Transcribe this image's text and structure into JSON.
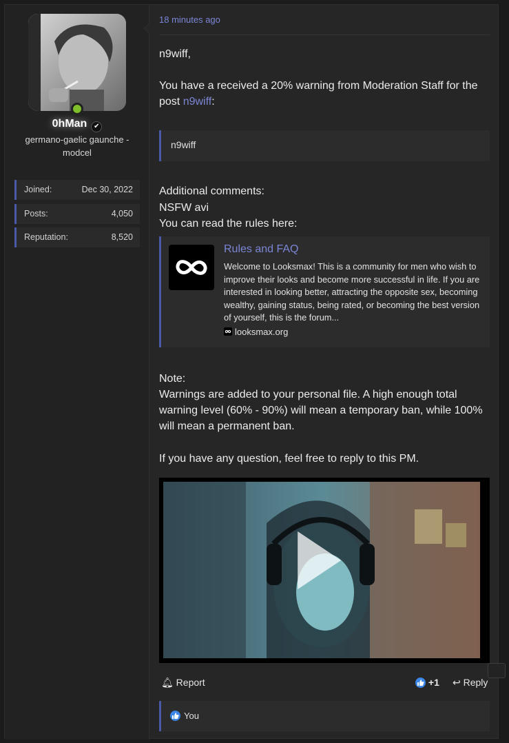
{
  "user": {
    "username": "0hMan",
    "title": "germano-gaelic gaunche - modcel",
    "stats": [
      {
        "label": "Joined:",
        "value": "Dec 30, 2022"
      },
      {
        "label": "Posts:",
        "value": "4,050"
      },
      {
        "label": "Reputation:",
        "value": "8,520"
      }
    ],
    "online_color": "#7fbf2a"
  },
  "post": {
    "timestamp": "18 minutes ago",
    "greeting": "n9wiff,",
    "warning_prefix": "You have a received a 20% warning from Moderation Staff for the post ",
    "warning_link": "n9wiff",
    "warning_suffix": ":",
    "quote": "n9wiff",
    "comments_label": "Additional comments:",
    "comments_value": "NSFW avi",
    "rules_line": "You can read the rules here:",
    "embed": {
      "title": "Rules and FAQ",
      "description": "Welcome to Looksmax! This is a community for men who wish to improve their looks and become more successful in life. If you are interested in looking better, attracting the opposite sex, becoming wealthy, gaining status, being rated, or becoming the best version of yourself, this is the forum...",
      "domain": "looksmax.org"
    },
    "note_label": "Note:",
    "note_text": "Warnings are added to your personal file. A high enough total warning level (60% - 90%) will mean a temporary ban, while 100% will mean a permanent ban.",
    "question": "If you have any question, feel free to reply to this PM."
  },
  "actions": {
    "report": "Report",
    "like_count": "+1",
    "reply": "Reply"
  },
  "reactions": {
    "text": "You"
  },
  "colors": {
    "accent": "#7c86d6",
    "border_accent": "#4a5aa8",
    "like_blue": "#3b86e6"
  }
}
